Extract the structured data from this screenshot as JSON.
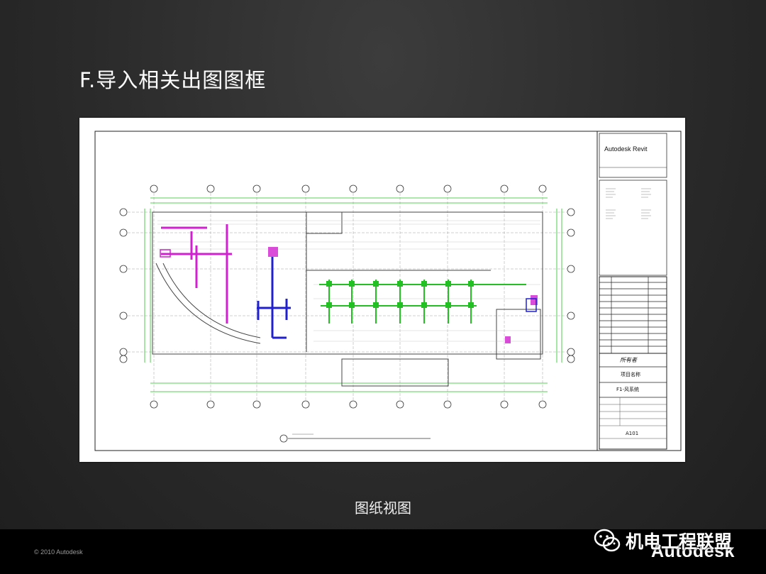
{
  "slide": {
    "title": "F.导入相关出图图框",
    "caption": "图纸视图"
  },
  "titleblock": {
    "logo": "Autodesk Revit",
    "owner": "所有者",
    "project_name": "项目名称",
    "sheet_name": "F1-风系统",
    "sheet_number": "A101"
  },
  "footer": {
    "copyright": "© 2010 Autodesk",
    "brand": "Autodesk",
    "watermark": "机电工程联盟"
  },
  "colors": {
    "background": "#2a2a2a",
    "footer_bar": "#000000",
    "duct_green": "#22c022",
    "duct_magenta": "#d020d0",
    "duct_blue": "#2020d0"
  }
}
